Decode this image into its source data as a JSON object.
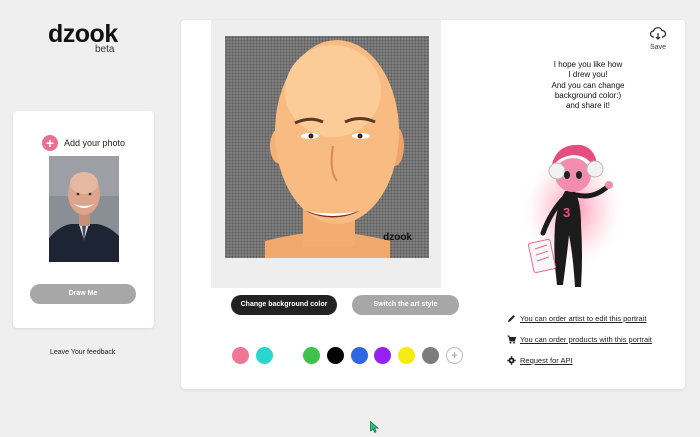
{
  "brand": {
    "name": "dzook",
    "tag": "beta"
  },
  "upload": {
    "add_photo_label": "Add your photo",
    "draw_button": "Draw Me"
  },
  "feedback_link": "Leave Your feedback",
  "portrait": {
    "watermark": "dzook"
  },
  "actions": {
    "change_bg": "Change background color",
    "switch_style": "Switch the art style"
  },
  "colors": {
    "swatches": [
      "#ef7694",
      "#2bd6cf",
      "#ffffff",
      "#3ec24a",
      "#050505",
      "#2f67e0",
      "#9622ef",
      "#f4ec10",
      "#7c7c7c"
    ],
    "add_icon": "+"
  },
  "save": {
    "label": "Save",
    "icon": "download-cloud-icon"
  },
  "message": {
    "lines": [
      "I hope you like how",
      "I drew you!",
      "And you can change",
      "background color:)",
      "and share it!"
    ]
  },
  "character": {
    "badge": "3"
  },
  "links": [
    {
      "text": "You can order artist to edit this portrait",
      "icon": "pencil-icon"
    },
    {
      "text": "You can order products with this portrait",
      "icon": "cart-icon"
    },
    {
      "text": "Request for API",
      "icon": "gear-icon"
    }
  ]
}
